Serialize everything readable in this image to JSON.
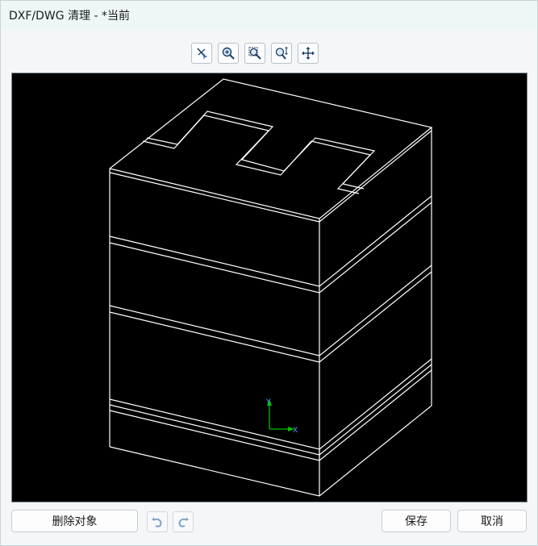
{
  "window": {
    "title": "DXF/DWG 清理 - *当前"
  },
  "toolbar": {
    "items": [
      {
        "name": "select-pick-icon"
      },
      {
        "name": "zoom-in-icon"
      },
      {
        "name": "zoom-window-icon"
      },
      {
        "name": "zoom-realtime-icon"
      },
      {
        "name": "pan-icon"
      }
    ]
  },
  "viewport": {
    "background": "#000000",
    "line_color": "#ffffff",
    "ucs": {
      "y_label": "Y",
      "x_label": "X",
      "y_color": "#00c000",
      "x_color": "#00c000"
    }
  },
  "footer": {
    "delete_label": "删除对象",
    "undo_icon": "undo-icon",
    "redo_icon": "redo-icon",
    "save_label": "保存",
    "cancel_label": "取消"
  }
}
